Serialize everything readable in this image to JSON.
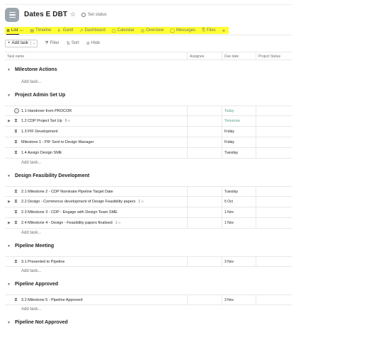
{
  "header": {
    "title": "Dates E  DBT",
    "set_status": "Set status"
  },
  "tabs": [
    {
      "label": "List",
      "icon": "list-icon",
      "glyph": "≣"
    },
    {
      "label": "Timeline",
      "icon": "timeline-icon",
      "glyph": "▤"
    },
    {
      "label": "Gantt",
      "icon": "gantt-icon",
      "glyph": "⊩"
    },
    {
      "label": "Dashboard",
      "icon": "dashboard-icon",
      "glyph": "↗"
    },
    {
      "label": "Calendar",
      "icon": "calendar-icon",
      "glyph": "▢"
    },
    {
      "label": "Overview",
      "icon": "overview-icon",
      "glyph": "◎"
    },
    {
      "label": "Messages",
      "icon": "messages-icon",
      "glyph": "◯"
    },
    {
      "label": "Files",
      "icon": "files-icon",
      "glyph": "⎘"
    }
  ],
  "toolbar": {
    "add_task": "Add task",
    "filter": "Filter",
    "sort": "Sort",
    "hide": "Hide"
  },
  "columns": {
    "task_name": "Task name",
    "assignee": "Assignee",
    "due_date": "Due date",
    "project_status": "Project Status"
  },
  "add_task_link": "Add task...",
  "sections": [
    {
      "name": "Milestone Actions",
      "tasks": []
    },
    {
      "name": "Project Admin Set Up",
      "tasks": [
        {
          "name": "1.1 Handover from PROCOR",
          "subtasks": "",
          "due": "Today",
          "kind": "check",
          "expand": false,
          "due_color": "green"
        },
        {
          "name": "1.2 CDP Project Set Up",
          "subtasks": "9 ‹›",
          "due": "Tomorrow",
          "kind": "hourglass",
          "expand": true,
          "due_color": "green"
        },
        {
          "name": "1.3 PIF Development",
          "subtasks": "",
          "due": "Friday",
          "kind": "hourglass",
          "expand": false,
          "due_color": ""
        },
        {
          "name": "Milestone 1 - PIF Sent to Design Manager",
          "subtasks": "",
          "due": "Friday",
          "kind": "hourglass",
          "expand": false,
          "due_color": ""
        },
        {
          "name": "1.4 Assign Design SME",
          "subtasks": "",
          "due": "Tuesday",
          "kind": "hourglass",
          "expand": false,
          "due_color": ""
        }
      ]
    },
    {
      "name": "Design Feasibility Development",
      "tasks": [
        {
          "name": "2.1 Milestone 2 - CDP Nominate Pipeline Target Date",
          "subtasks": "",
          "due": "Tuesday",
          "kind": "hourglass",
          "expand": false,
          "due_color": ""
        },
        {
          "name": "2.2 Design - Commence development of Design Feasibility papers",
          "subtasks": "1 ‹›",
          "due": "5 Oct",
          "kind": "hourglass",
          "expand": true,
          "due_color": ""
        },
        {
          "name": "2.3 Milestone 3 - CDP - Engage with Design Team SME",
          "subtasks": "",
          "due": "1 Nov",
          "kind": "hourglass",
          "expand": false,
          "due_color": ""
        },
        {
          "name": "2.4 Milestone 4 - Design - Feasibility papers finalised",
          "subtasks": "1 ‹›",
          "due": "1 Nov",
          "kind": "hourglass",
          "expand": true,
          "due_color": ""
        }
      ]
    },
    {
      "name": "Pipeline Meeting",
      "tasks": [
        {
          "name": "3.1 Presented to Pipeline",
          "subtasks": "",
          "due": "3 Nov",
          "kind": "hourglass",
          "expand": false,
          "due_color": ""
        }
      ]
    },
    {
      "name": "Pipeline Approved",
      "tasks": [
        {
          "name": "3.2 Milestone 5 - Pipeline Approved",
          "subtasks": "",
          "due": "3 Nov",
          "kind": "hourglass",
          "expand": false,
          "due_color": ""
        }
      ]
    },
    {
      "name": "Pipeline Not Approved",
      "tasks": []
    }
  ],
  "colors": {
    "tab_highlight": "#ffff33",
    "due_green": "#58a182",
    "project_icon": "#9ca6af"
  }
}
